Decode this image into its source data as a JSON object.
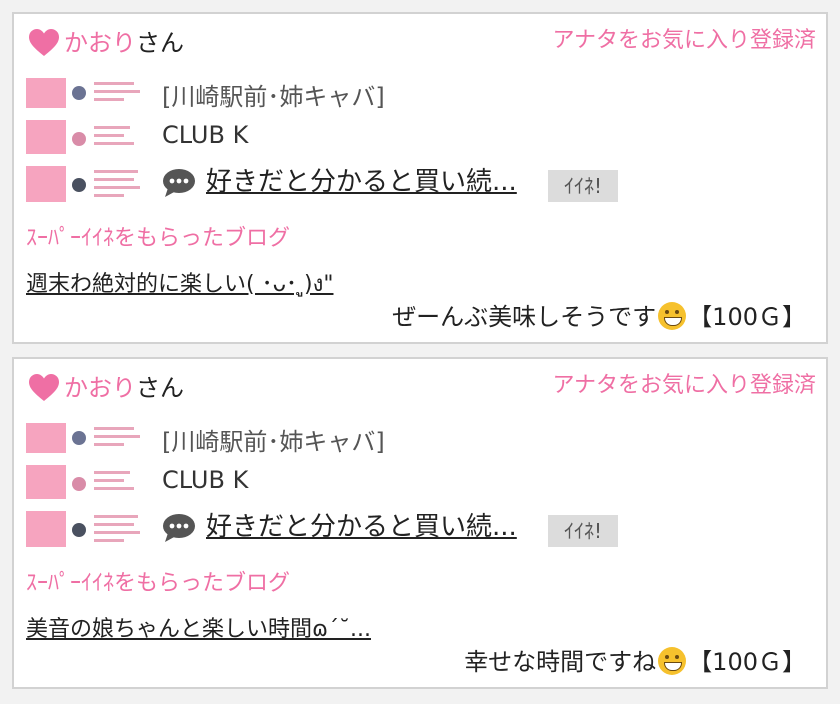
{
  "entries": [
    {
      "user_name": "かおり",
      "user_suffix": "さん",
      "favorite_status": "アナタをお気に入り登録済",
      "shop_area": "[川崎駅前･姉キャバ]",
      "shop_name": "CLUB K",
      "blog_title": "好きだと分かると買い続...",
      "iine_label": "ｲｲﾈ!",
      "super_iine_label": "ｽｰﾊﾟｰｲｲﾈをもらったブログ",
      "post_title": "週末わ絶対的に楽しい( ･ᴗ･ ู)ง\"",
      "comment_text": "ぜーんぶ美味しそうです",
      "reward": "【100Ｇ】"
    },
    {
      "user_name": "かおり",
      "user_suffix": "さん",
      "favorite_status": "アナタをお気に入り登録済",
      "shop_area": "[川崎駅前･姉キャバ]",
      "shop_name": "CLUB K",
      "blog_title": "好きだと分かると買い続...",
      "iine_label": "ｲｲﾈ!",
      "super_iine_label": "ｽｰﾊﾟｰｲｲﾈをもらったブログ",
      "post_title": "美音の娘ちゃんと楽しい時間ɷ´˘...",
      "comment_text": "幸せな時間ですね",
      "reward": "【100Ｇ】"
    }
  ],
  "colors": {
    "accent_pink": "#ef6fa4",
    "iine_bg": "#dcdcdc"
  },
  "icons": {
    "heart": "heart-icon",
    "bubble": "speech-bubble-icon",
    "emoji": "grinning-face-icon"
  }
}
